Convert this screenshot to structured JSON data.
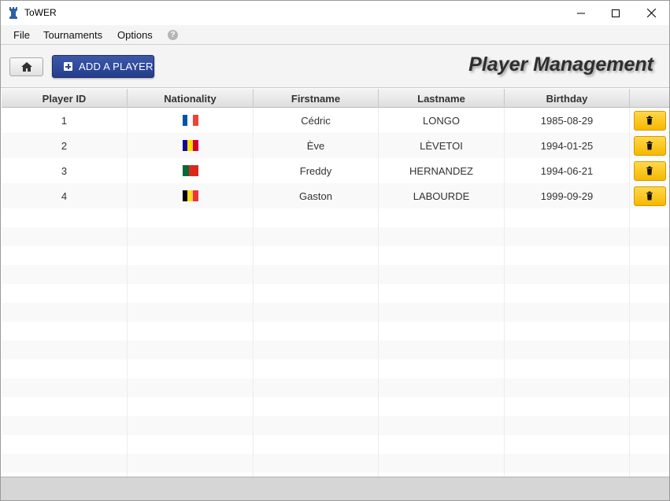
{
  "window": {
    "title": "ToWER",
    "icon": "rook-icon",
    "controls": [
      "minimize-icon",
      "maximize-icon",
      "close-icon"
    ]
  },
  "menu": {
    "items": [
      {
        "label": "File"
      },
      {
        "label": "Tournaments"
      },
      {
        "label": "Options"
      }
    ],
    "help_icon": "?"
  },
  "toolbar": {
    "home_icon": "home-icon",
    "add_label": "ADD A PLAYER",
    "add_icon": "plus-square-icon",
    "page_title": "Player Management"
  },
  "table": {
    "columns": [
      "Player ID",
      "Nationality",
      "Firstname",
      "Lastname",
      "Birthday",
      ""
    ],
    "rows": [
      {
        "id": "1",
        "nationality": "france-flag-icon",
        "firstname": "Cédric",
        "lastname": "LONGO",
        "birthday": "1985-08-29"
      },
      {
        "id": "2",
        "nationality": "andorra-flag-icon",
        "firstname": "Ève",
        "lastname": "LÈVETOI",
        "birthday": "1994-01-25"
      },
      {
        "id": "3",
        "nationality": "portugal-flag-icon",
        "firstname": "Freddy",
        "lastname": "HERNANDEZ",
        "birthday": "1994-06-21"
      },
      {
        "id": "4",
        "nationality": "belgium-flag-icon",
        "firstname": "Gaston",
        "lastname": "LABOURDE",
        "birthday": "1999-09-29"
      }
    ],
    "delete_icon": "trash-icon"
  },
  "colors": {
    "add_button": "#2c468f",
    "delete_button": "#f6b800",
    "flag_france": [
      "#0055a4",
      "#ffffff",
      "#ef4135"
    ],
    "flag_andorra": [
      "#10069f",
      "#fedd00",
      "#d50032"
    ],
    "flag_portugal": [
      "#046a38",
      "#da291c"
    ],
    "flag_belgium": [
      "#000000",
      "#fdda24",
      "#ef3340"
    ]
  }
}
